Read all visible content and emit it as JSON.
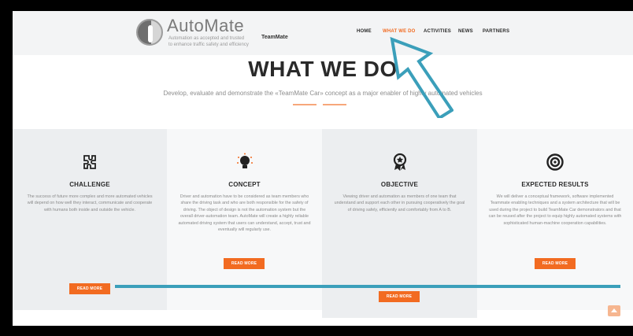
{
  "header": {
    "logo_title": "AutoMate",
    "logo_tag_line1": "Automation as accepted and trusted",
    "logo_tag_line2": "to enhance traffic safety and efficiency",
    "logo_team": "TeamMate"
  },
  "nav": {
    "items": [
      {
        "label": "HOME",
        "active": false
      },
      {
        "label": "WHAT WE DO",
        "active": true
      },
      {
        "label": "ACTIVITIES",
        "active": false
      },
      {
        "label": "NEWS",
        "active": false
      },
      {
        "label": "PARTNERS",
        "active": false
      }
    ]
  },
  "hero": {
    "title": "WHAT WE DO",
    "subtitle": "Develop, evaluate and demonstrate the «TeamMate Car» concept as a major enabler of highly automated vehicles"
  },
  "features": [
    {
      "icon": "puzzle-car-icon",
      "title": "CHALLENGE",
      "text": "The success of future more complex and more automated vehicles will depend on how well they interact, communicate and cooperate with humans both inside and outside the vehicle.",
      "button": "READ MORE"
    },
    {
      "icon": "lightbulb-icon",
      "title": "CONCEPT",
      "text": "Driver and automation have to be considered as team members who share the driving task and who are both responsible for the safety of driving. The object of design is not the automation system but the overall driver-automation team. AutoMate will create a highly reliable automated driving system that users can understand, accept, trust and eventually will regularly use.",
      "button": "READ MORE"
    },
    {
      "icon": "award-ribbon-icon",
      "title": "OBJECTIVE",
      "text": "Viewing driver and automation as members of one team that understand and support each other in pursuing cooperatively the goal of driving safely, efficiently and comfortably from A to B.",
      "button": "READ MORE"
    },
    {
      "icon": "target-icon",
      "title": "EXPECTED RESULTS",
      "text": "We will deliver a conceptual framework, software implemented Teammate enabling techniques and a system architecture that will be used during the project to build TeamMate Car demonstrators and that can be reused after the project to equip highly automated systems with sophisticated human-machine cooperation capabilities.",
      "button": "READ MORE"
    }
  ],
  "colors": {
    "accent": "#f26b21",
    "annotation": "#3b9fba",
    "text_dark": "#2a2a2a",
    "text_muted": "#8a8a8a"
  }
}
